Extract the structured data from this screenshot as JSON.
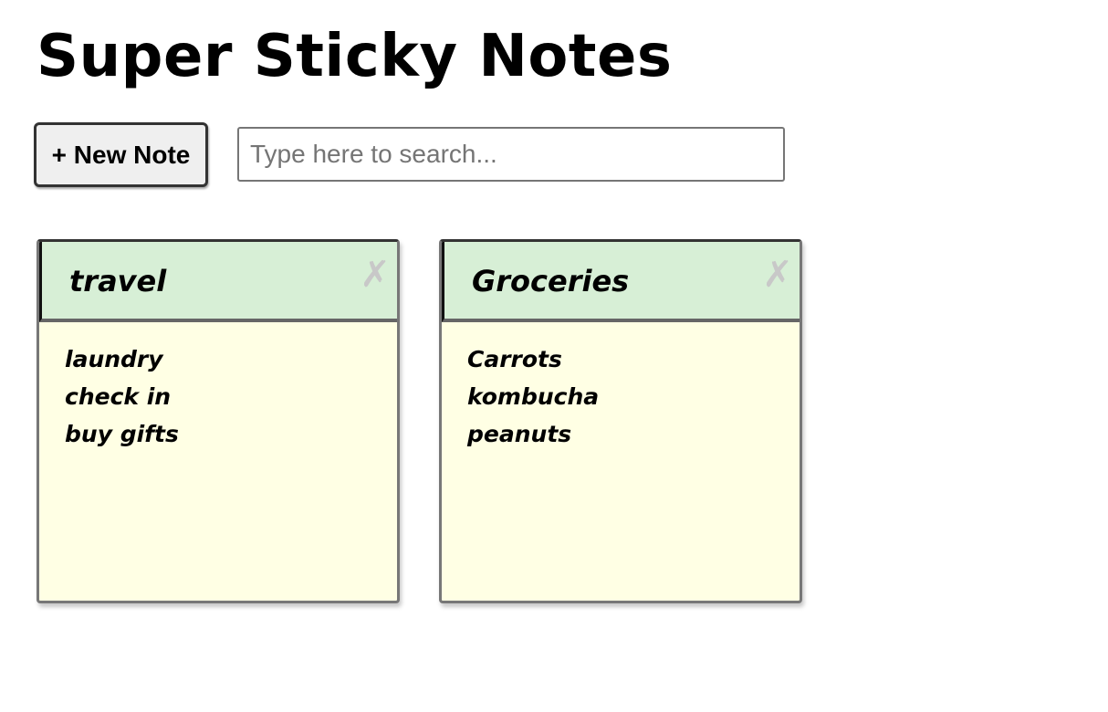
{
  "app": {
    "title": "Super Sticky Notes"
  },
  "toolbar": {
    "new_note_label": "+ New Note",
    "search_placeholder": "Type here to search...",
    "search_value": ""
  },
  "notes": [
    {
      "title": "travel",
      "lines": [
        "laundry",
        "check in",
        "buy gifts"
      ],
      "delete_glyph": "✗"
    },
    {
      "title": "Groceries",
      "lines": [
        "Carrots",
        "kombucha",
        "peanuts"
      ],
      "delete_glyph": "✗"
    }
  ],
  "colors": {
    "note_header": "#d7efd6",
    "note_body": "#ffffe4",
    "delete_icon": "#c8c8c8",
    "button_bg": "#efefef"
  }
}
